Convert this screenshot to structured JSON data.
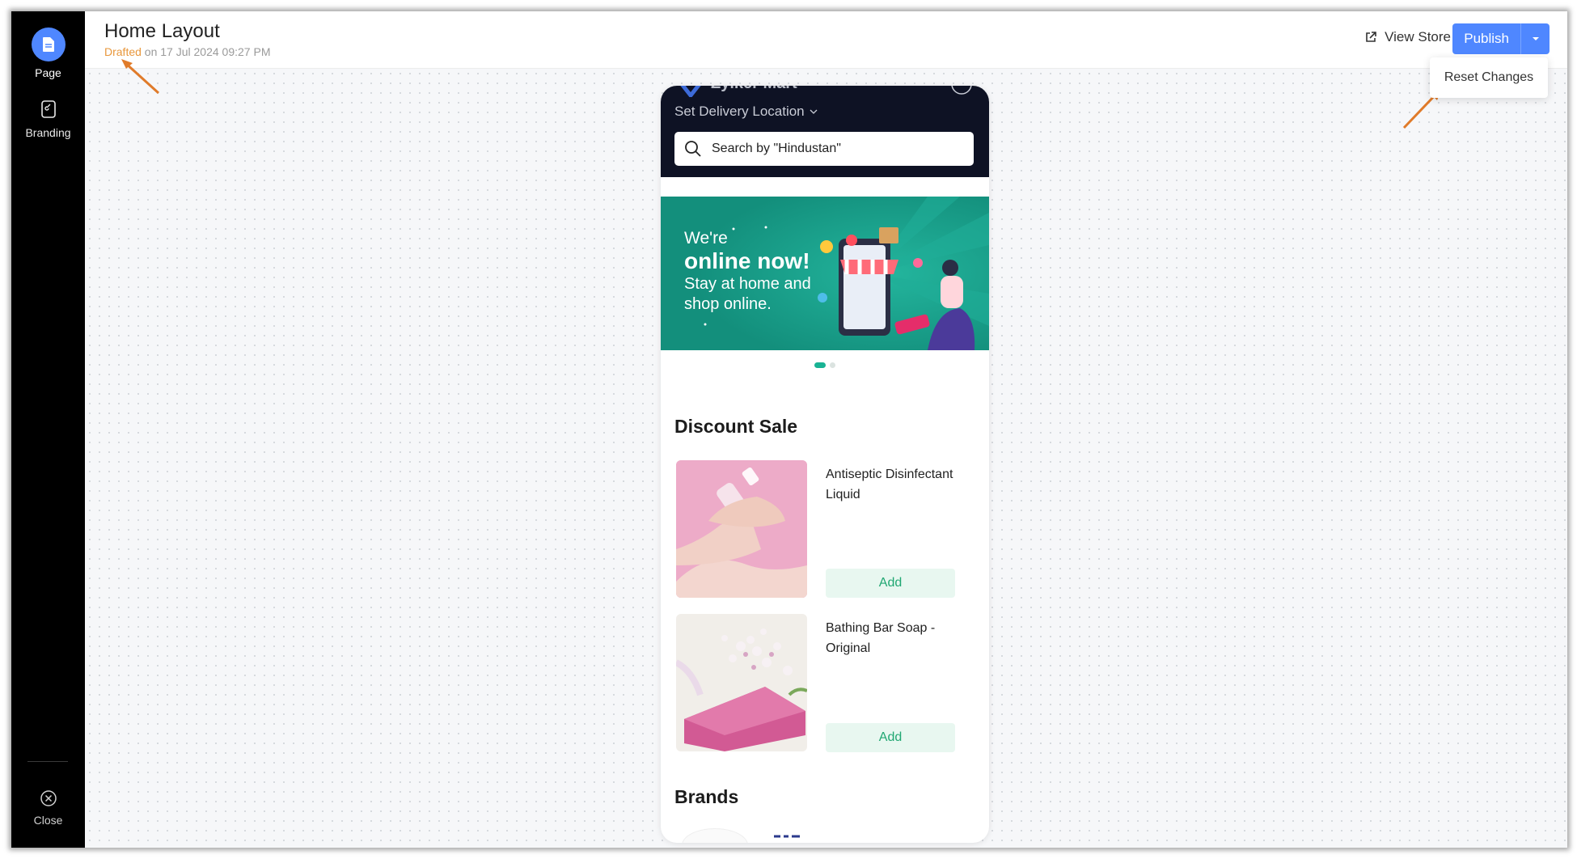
{
  "sidebar": {
    "items": [
      {
        "label": "Page",
        "icon": "page-icon"
      },
      {
        "label": "Branding",
        "icon": "branding-icon"
      }
    ],
    "close_label": "Close"
  },
  "header": {
    "title": "Home Layout",
    "status": "Drafted",
    "status_suffix": " on 17 Jul 2024 09:27 PM",
    "view_store": "View Store",
    "publish": "Publish",
    "dropdown_item": "Reset Changes"
  },
  "preview": {
    "brand_name": "Zylker Mart",
    "delivery_location": "Set Delivery Location",
    "search_placeholder": "Search by \"Hindustan\"",
    "banner": {
      "line1": "We're",
      "line2": "online now!",
      "line3": "Stay at home and shop online."
    },
    "discount_title": "Discount Sale",
    "products": [
      {
        "name": "Antiseptic Disinfectant Liquid",
        "button": "Add"
      },
      {
        "name": "Bathing Bar Soap - Original",
        "button": "Add"
      }
    ],
    "brands_title": "Brands"
  },
  "colors": {
    "accent": "#4f87ff",
    "drafted": "#e8973c",
    "annotation_arrow": "#e07b2a",
    "add_button_text": "#20a772"
  }
}
